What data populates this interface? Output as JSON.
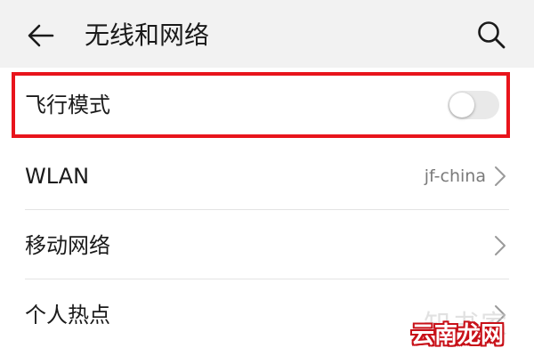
{
  "header": {
    "title": "无线和网络",
    "back_icon": "arrow-left-icon",
    "search_icon": "search-icon"
  },
  "rows": [
    {
      "label": "飞行模式",
      "control": "toggle",
      "toggle_on": false
    },
    {
      "label": "WLAN",
      "value": "jf-china",
      "control": "chevron"
    },
    {
      "label": "移动网络",
      "control": "chevron"
    },
    {
      "label": "个人热点",
      "control": "chevron"
    }
  ],
  "colors": {
    "header_bg": "#f2f2f2",
    "highlight_border": "#e8141c",
    "toggle_off_track": "#e9e9e9",
    "secondary_text": "#7a7a7a"
  },
  "watermark": {
    "line1": "知书家",
    "line2": "云南龙网"
  }
}
